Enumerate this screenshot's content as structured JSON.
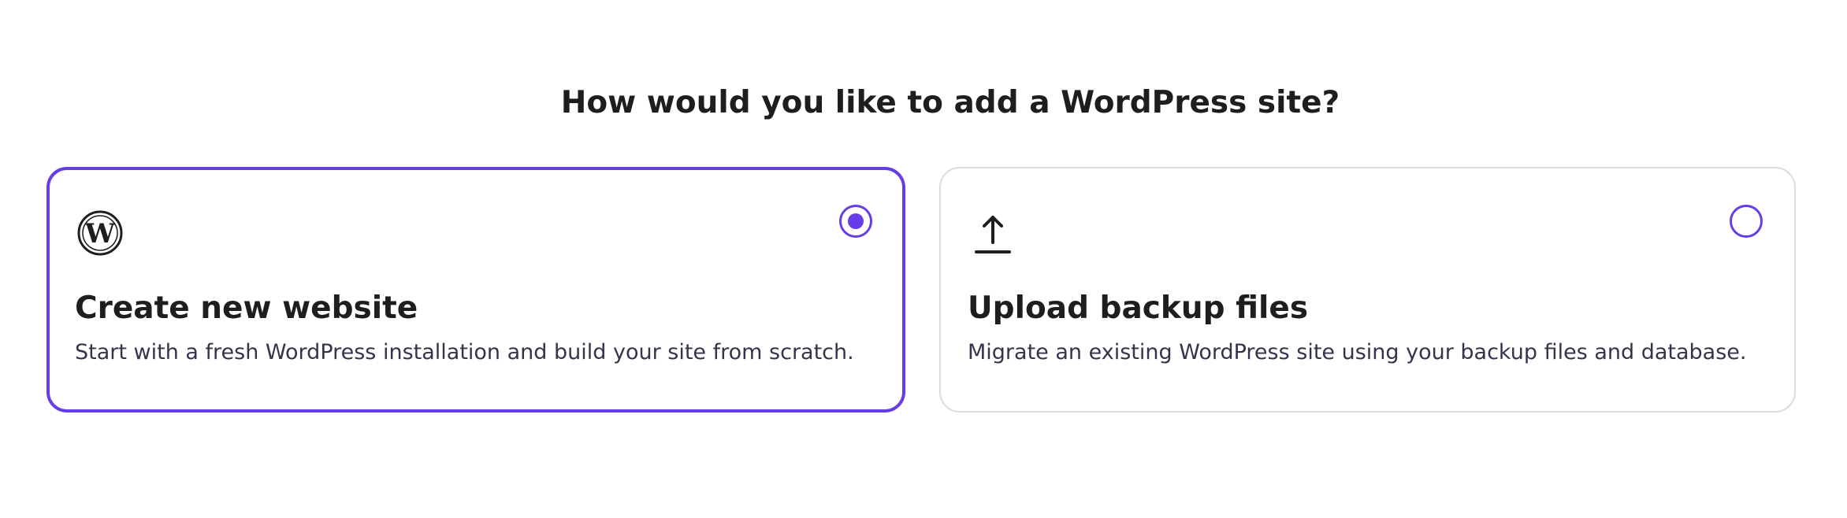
{
  "heading": "How would you like to add a WordPress site?",
  "accent_color": "#673de6",
  "options": [
    {
      "icon": "wordpress-logo-icon",
      "title": "Create new website",
      "description": "Start with a fresh WordPress installation and build your site from scratch.",
      "selected": true
    },
    {
      "icon": "upload-icon",
      "title": "Upload backup files",
      "description": "Migrate an existing WordPress site using your backup files and database.",
      "selected": false
    }
  ]
}
